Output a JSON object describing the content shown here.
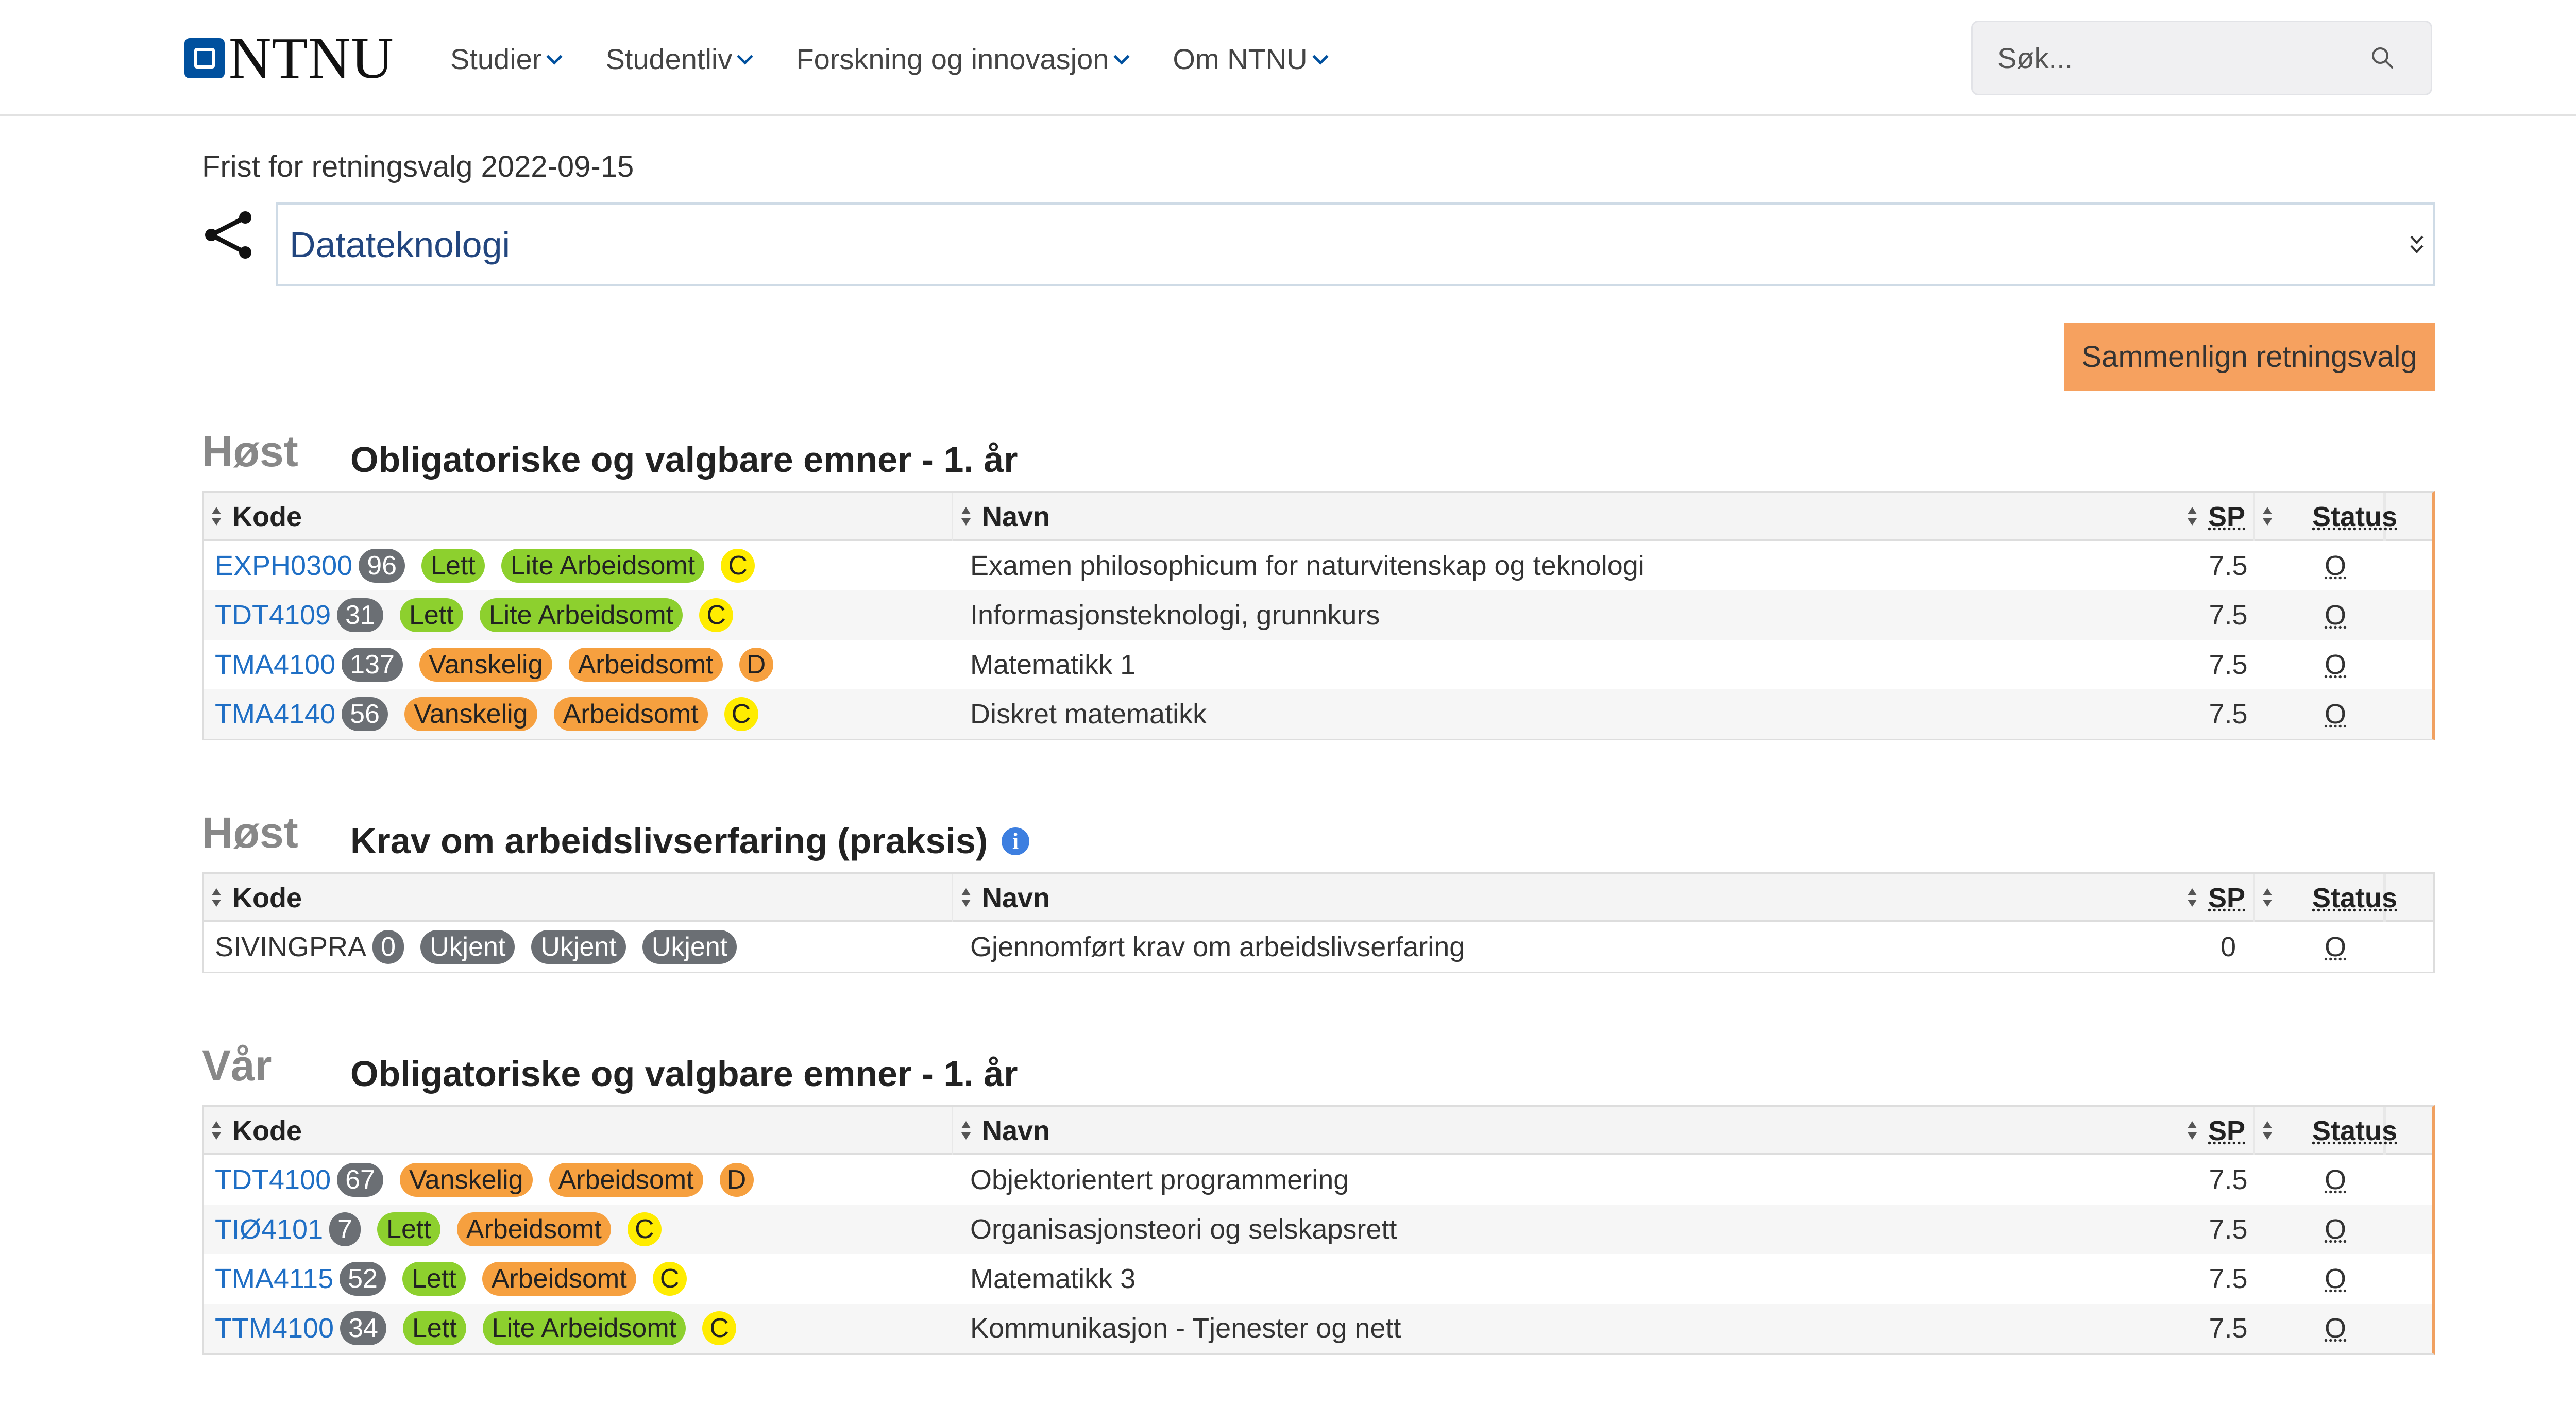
{
  "header": {
    "logo_text": "NTNU",
    "nav": [
      {
        "label": "Studier"
      },
      {
        "label": "Studentliv"
      },
      {
        "label": "Forskning og innovasjon"
      },
      {
        "label": "Om NTNU"
      }
    ],
    "search_placeholder": "Søk..."
  },
  "page": {
    "deadline_text": "Frist for retningsvalg 2022-09-15",
    "selected_track": "Datateknologi",
    "compare_button": "Sammenlign retningsvalg"
  },
  "table_headers": {
    "kode": "Kode",
    "navn": "Navn",
    "sp": "SP",
    "status": "Status"
  },
  "sections": [
    {
      "semester": "Høst",
      "title": "Obligatoriske og valgbare emner - 1. år",
      "courses": [
        {
          "code": "EXPH0300",
          "count": "96",
          "difficulty": "Lett",
          "workload": "Lite Arbeidsomt",
          "grade": "C",
          "name": "Examen philosophicum for naturvitenskap og teknologi",
          "sp": "7.5",
          "status": "O"
        },
        {
          "code": "TDT4109",
          "count": "31",
          "difficulty": "Lett",
          "workload": "Lite Arbeidsomt",
          "grade": "C",
          "name": "Informasjonsteknologi, grunnkurs",
          "sp": "7.5",
          "status": "O"
        },
        {
          "code": "TMA4100",
          "count": "137",
          "difficulty": "Vanskelig",
          "workload": "Arbeidsomt",
          "grade": "D",
          "name": "Matematikk 1",
          "sp": "7.5",
          "status": "O"
        },
        {
          "code": "TMA4140",
          "count": "56",
          "difficulty": "Vanskelig",
          "workload": "Arbeidsomt",
          "grade": "C",
          "name": "Diskret matematikk",
          "sp": "7.5",
          "status": "O"
        }
      ]
    },
    {
      "semester": "Høst",
      "title": "Krav om arbeidslivserfaring (praksis)",
      "info_icon": "i",
      "courses": [
        {
          "code": "SIVINGPRA",
          "count": "0",
          "difficulty": "Ukjent",
          "workload": "Ukjent",
          "grade": "Ukjent",
          "name": "Gjennomført krav om arbeidslivserfaring",
          "sp": "0",
          "status": "O"
        }
      ]
    },
    {
      "semester": "Vår",
      "title": "Obligatoriske og valgbare emner - 1. år",
      "courses": [
        {
          "code": "TDT4100",
          "count": "67",
          "difficulty": "Vanskelig",
          "workload": "Arbeidsomt",
          "grade": "D",
          "name": "Objektorientert programmering",
          "sp": "7.5",
          "status": "O"
        },
        {
          "code": "TIØ4101",
          "count": "7",
          "difficulty": "Lett",
          "workload": "Arbeidsomt",
          "grade": "C",
          "name": "Organisasjonsteori og selskapsrett",
          "sp": "7.5",
          "status": "O"
        },
        {
          "code": "TMA4115",
          "count": "52",
          "difficulty": "Lett",
          "workload": "Arbeidsomt",
          "grade": "C",
          "name": "Matematikk 3",
          "sp": "7.5",
          "status": "O"
        },
        {
          "code": "TTM4100",
          "count": "34",
          "difficulty": "Lett",
          "workload": "Lite Arbeidsomt",
          "grade": "C",
          "name": "Kommunikasjon - Tjenester og nett",
          "sp": "7.5",
          "status": "O"
        }
      ]
    }
  ],
  "colors": {
    "brand": "#00509e",
    "accent": "#f6a15f",
    "easy": "#8dd02e",
    "hard": "#f6a03f",
    "grade_c": "#ffec00",
    "link": "#1f6fc5"
  },
  "icons": {
    "search": "search-icon",
    "branch": "branch-icon",
    "sort": "sort-icon",
    "info": "info-icon",
    "chevron": "chevron-down-icon"
  }
}
